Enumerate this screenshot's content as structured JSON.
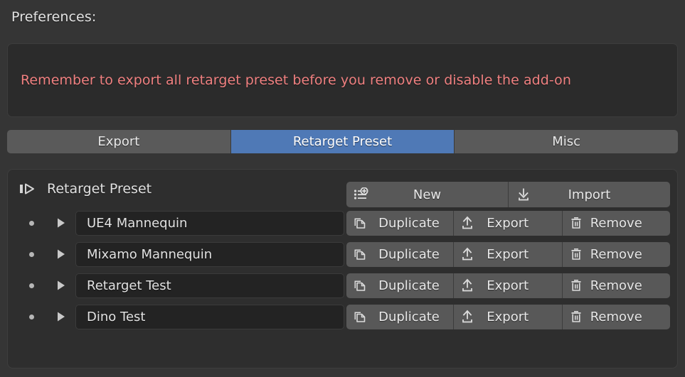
{
  "colors": {
    "background": "#353535",
    "panel": "#2e2e2e",
    "warning_box": "#2b2b2b",
    "warning_text": "#ef8080",
    "tab_inactive": "#5a5a5a",
    "tab_active": "#4f79b6",
    "button": "#585858",
    "field": "#232323",
    "text": "#e4e4e4"
  },
  "header": {
    "prefs_label": "Preferences:"
  },
  "warning": {
    "message": "Remember to export all retarget preset before you remove or disable the add-on"
  },
  "tabs": [
    {
      "label": "Export",
      "active": false,
      "name": "tab-export"
    },
    {
      "label": "Retarget Preset",
      "active": true,
      "name": "tab-retarget-preset"
    },
    {
      "label": "Misc",
      "active": false,
      "name": "tab-misc"
    }
  ],
  "panel": {
    "title": "Retarget Preset",
    "toggle_icon": "expand-collapse-icon",
    "actions": [
      {
        "label": "New",
        "icon": "list-add-icon",
        "name": "new-preset-button"
      },
      {
        "label": "Import",
        "icon": "import-download-icon",
        "name": "import-preset-button"
      }
    ]
  },
  "row_actions": [
    {
      "label": "Duplicate",
      "icon": "duplicate-icon",
      "name": "duplicate-button"
    },
    {
      "label": "Export",
      "icon": "export-upload-icon",
      "name": "export-button"
    },
    {
      "label": "Remove",
      "icon": "trash-icon",
      "name": "remove-button"
    }
  ],
  "presets": [
    {
      "name": "UE4 Mannequin"
    },
    {
      "name": "Mixamo Mannequin"
    },
    {
      "name": "Retarget Test"
    },
    {
      "name": "Dino Test"
    }
  ]
}
